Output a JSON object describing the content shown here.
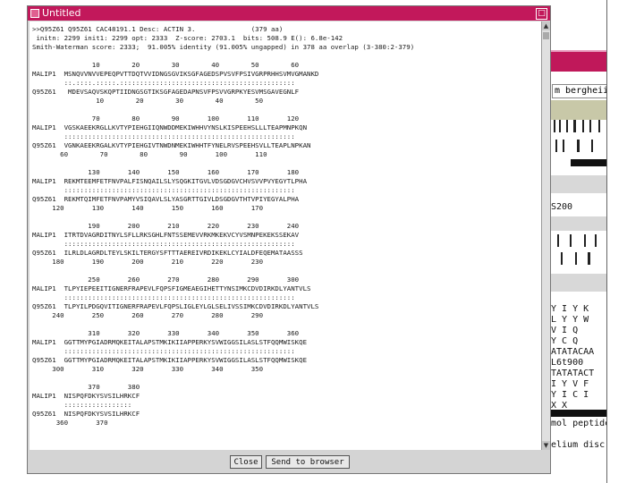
{
  "window": {
    "title": "Untitled",
    "close_label": "Close",
    "send_label": "Send to browser"
  },
  "alignment": {
    "lines": [
      ">>Q95Z61 Q95Z61 CAC48191.1 Desc: ACTIN 3.              (379 aa)",
      " initn: 2299 init1: 2299 opt: 2333  Z-score: 2703.1  bits: 508.9 E(): 6.8e-142",
      "Smith-Waterman score: 2333;  91.005% identity (91.005% ungapped) in 378 aa overlap (3-380:2-379)",
      "",
      "               10        20        30        40        50        60",
      "MALIP1  MSNQVVNVVEPEQPVTTDQTVVIDNGSGVIKSGFAGEDSPVSVFPSIVGRPRHHSVMVGMANKD",
      "        ::.::::.:::::.::::::::::::::::::::::::::::::::::::::::::::",
      "Q95Z61   MDEVSAQVSKQPTIIDNGSGTIKSGFAGEDAPNSVFPSVVGRPKYESVMSGAVEGNLF",
      "                10        20        30        40        50",
      "",
      "               70        80        90       100       110       120",
      "MALIP1  VGSKAEEKRGLLKVTYPIEHGIIQNWDDMEKIWHHVYNSLKISPEEHSLLLTEAPMNPKQN",
      "        ::::::::::::::::::::::::::::::::::::::::::::::::::::::::::",
      "Q95Z61  VGNKAEEKRGALKVTYPIEHGIVTNWDNMEKIWHHTFYNELRVSPEEHSVLLTEAPLNPKAN",
      "       60        70        80        90       100       110",
      "",
      "              130       140       150       160       170       180",
      "MALIP1  REKMTEEMFETFNVPALFISNQAILSLYSQGKITGVLVDSGDGVCHVSVVPVYEGYTLPHA",
      "        ::::::::::::::::::::::::::::::::::::::::::::::::::::::::::",
      "Q95Z61  REKMTQIMFETFNVPAMYVSIQAVLSLYASGRTTGIVLDSGDGVTHTVPIYEGYALPHA",
      "     120       130       140       150       160       170",
      "",
      "              190       200       210       220       230       240",
      "MALIP1  ITRTDVAGRDITNYLSFLLRKSGHLFNTSSEMEVVRKMKEKVCYVSMNPEKEKSSEKAV",
      "        ::::::::::::::::::::::::::::::::::::::::::::::::::::::::::",
      "Q95Z61  ILRLDLAGRDLTEYLSKILTERGYSFTTTAEREIVRDIKEKLCYIALDFEQEMATAASSS",
      "     180       190       200       210       220       230",
      "",
      "              250       260       270       280       290       300",
      "MALIP1  TLPYIEPEEITIGNERFRAPEVLFQPSFIGMEAEGIHETTYNSIMKCDVDIRKDLYANTVLS",
      "        ::::::::::::::::::::::::::::::::::::::::::::::::::::::::::",
      "Q95Z61  TLPYILPDGQVITIGNERFRAPEVLFQPSLIGLEYLGLSELIVSSIMKCDVDIRKDLYANTVLS",
      "     240       250       260       270       280       290",
      "",
      "              310       320       330       340       350       360",
      "MALIP1  GGTTMYPGIADRMQKEITALAPSTMKIKIIAPPERKYSVWIGGSILASLSTFQQMWISKQE",
      "        ::::::::::::::::::::::::::::::::::::::::::::::::::::::::::",
      "Q95Z61  GGTTMYPGIADRMQKEITALAPSTMKIKIIAPPERKYSVWIGGSILASLSTFQQMWISKQE",
      "     300       310       320       330       340       350",
      "",
      "              370       380",
      "MALIP1  NISPQFDKYSVSILHRKCF",
      "        :::::::::::::::::",
      "Q95Z61  NISPQFDKYSVSILHRKCF",
      "      360       370"
    ]
  },
  "background": {
    "input_text": "m bergheii",
    "code_text": "S200",
    "seq_rows": [
      "Y I Y K",
      "L Y Y W",
      "V I Q",
      "Y C Q",
      "ATATACAA",
      "L6t900",
      "TATATACT",
      "I Y V F",
      "Y I C I",
      "X X"
    ],
    "tail_text": [
      "mol peptide",
      "elium disc"
    ]
  },
  "colors": {
    "title_bar": "#c2185b",
    "window_bg": "#d4d4d4",
    "content_bg": "#ffffff"
  }
}
